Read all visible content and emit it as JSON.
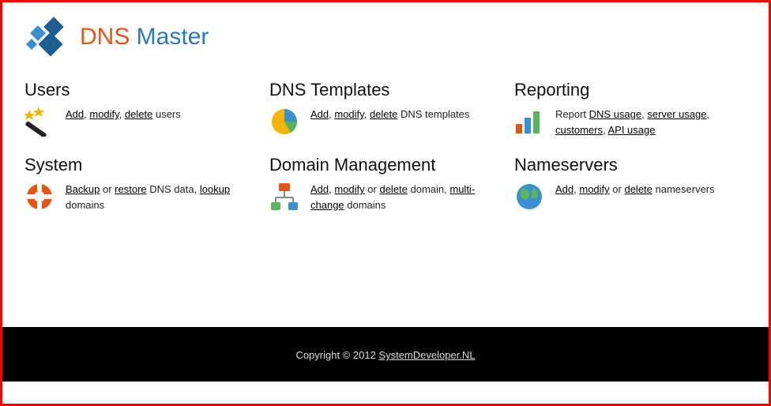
{
  "brand": {
    "part1": "DNS",
    "part2": " Master"
  },
  "cards": {
    "users": {
      "title": "Users",
      "links": {
        "add": "Add",
        "modify": "modify",
        "delete": "delete"
      },
      "suffix": " users"
    },
    "dns_templates": {
      "title": "DNS Templates",
      "links": {
        "add": "Add",
        "modify": "modify",
        "delete": "delete"
      },
      "suffix": " DNS templates"
    },
    "reporting": {
      "title": "Reporting",
      "prefix": "Report ",
      "links": {
        "dns": "DNS usage",
        "server": "server usage",
        "customers": "customers",
        "api": "API usage"
      }
    },
    "system": {
      "title": "System",
      "links": {
        "backup": "Backup",
        "restore": "restore",
        "lookup": "lookup"
      },
      "mid1": " or ",
      "mid2": " DNS data, ",
      "suffix": " domains"
    },
    "domain": {
      "title": "Domain Management",
      "links": {
        "add": "Add",
        "modify": "modify",
        "delete": "delete",
        "multi": "multi-change"
      },
      "mid": " or ",
      "mid2": " domain, ",
      "suffix": " domains"
    },
    "nameservers": {
      "title": "Nameservers",
      "links": {
        "add": "Add",
        "modify": "modify",
        "delete": "delete"
      },
      "mid": " or ",
      "suffix": " nameservers"
    }
  },
  "footer": {
    "copyright": "Copyright © 2012 ",
    "link": "SystemDeveloper.NL"
  }
}
